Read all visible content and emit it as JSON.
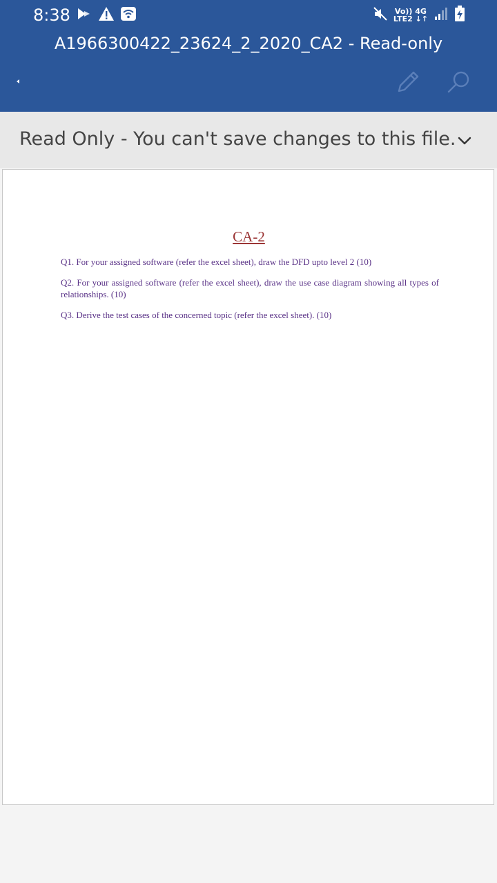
{
  "status_bar": {
    "time": "8:38",
    "network_top": "Vo)) 4G",
    "network_bottom": "LTE2 ↓↑",
    "icons": [
      "play-store-icon",
      "warning-icon",
      "wifi-icon",
      "mute-icon",
      "signal-icon",
      "battery-charging-icon"
    ]
  },
  "app_bar": {
    "title": "A1966300422_23624_2_2020_CA2 - Read-only",
    "icons": [
      "back-caret-icon",
      "edit-pencil-icon",
      "search-icon"
    ]
  },
  "readonly_banner": {
    "message": "Read Only - You can't save changes to this file.",
    "icon": "chevron-down-icon"
  },
  "document": {
    "heading": "CA-2",
    "questions": [
      "Q1. For your assigned software (refer the excel sheet), draw the DFD upto level 2 (10)",
      "Q2. For your assigned software (refer the excel sheet), draw the use case diagram showing all types of relationships. (10)",
      "Q3. Derive the test cases of the concerned topic (refer the excel sheet). (10)"
    ]
  },
  "colors": {
    "app_bar": "#2b579a",
    "banner": "#e8e8e8",
    "heading": "#9b3535",
    "question_text": "#5a3287"
  }
}
